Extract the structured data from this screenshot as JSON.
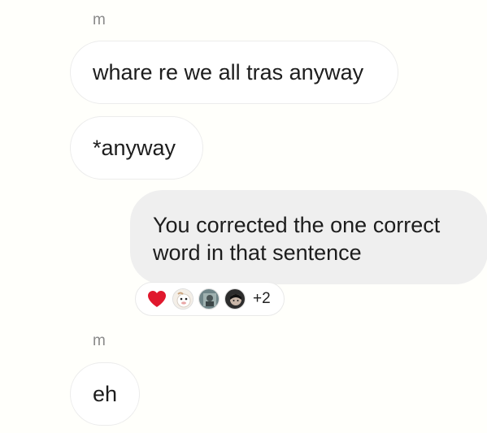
{
  "messages": [
    {
      "sender": "m",
      "text": "whare re we all tras anyway"
    },
    {
      "text": "*anyway"
    },
    {
      "text": "You corrected the one correct word in that sentence"
    },
    {
      "sender": "m",
      "text": "eh"
    }
  ],
  "outgoing_lines": [
    "You corrected the one correct",
    "word in that sentence"
  ],
  "reactions": {
    "icons": [
      "heart-icon",
      "avatar-1",
      "avatar-2",
      "avatar-3"
    ],
    "extra_count": "+2",
    "heart_color": "#e0182d"
  },
  "colors": {
    "incoming_bubble": "#ffffff",
    "outgoing_bubble": "#efefef",
    "background": "#fffffb"
  }
}
